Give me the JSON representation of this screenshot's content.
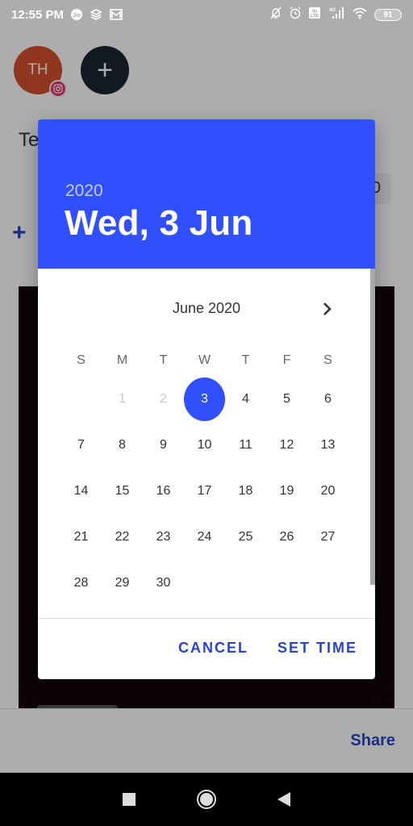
{
  "status_bar": {
    "time": "12:55 PM",
    "left_icons": [
      "jio-icon",
      "layers-icon",
      "gallery-icon"
    ],
    "right_icons": [
      "notifications-off-icon",
      "alarm-icon",
      "volte-icon",
      "signal-4g-icon",
      "wifi-icon"
    ],
    "battery": "91"
  },
  "app": {
    "avatar_initials": "TH",
    "avatar_badge": "instagram-icon",
    "add_account_label": "+",
    "text_label": "Te",
    "field_value": "0",
    "add_label": "+",
    "share_label": "Share"
  },
  "dialog": {
    "year": "2020",
    "selected_date": "Wed, 3 Jun",
    "month_label": "June 2020",
    "weekdays": [
      "S",
      "M",
      "T",
      "W",
      "T",
      "F",
      "S"
    ],
    "weeks": [
      [
        "",
        "1",
        "2",
        "3",
        "4",
        "5",
        "6"
      ],
      [
        "7",
        "8",
        "9",
        "10",
        "11",
        "12",
        "13"
      ],
      [
        "14",
        "15",
        "16",
        "17",
        "18",
        "19",
        "20"
      ],
      [
        "21",
        "22",
        "23",
        "24",
        "25",
        "26",
        "27"
      ],
      [
        "28",
        "29",
        "30",
        "",
        "",
        "",
        ""
      ]
    ],
    "disabled_days": [
      "1",
      "2"
    ],
    "selected_day": "3",
    "cancel_label": "CANCEL",
    "confirm_label": "SET TIME",
    "accent_color": "#304ffe"
  }
}
